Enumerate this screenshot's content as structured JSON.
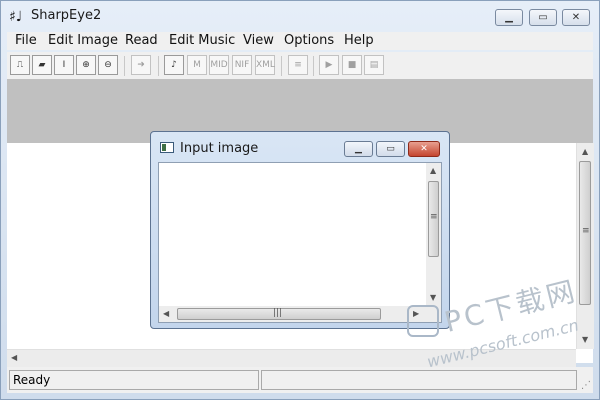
{
  "app": {
    "title": "SharpEye2",
    "icon": "sharp-note-icon",
    "icon_glyph": "♯♩",
    "caption": {
      "minimize": "▁",
      "maximize": "▭",
      "close": "✕"
    }
  },
  "menubar": {
    "items": [
      "File",
      "Edit Image",
      "Read",
      "Edit Music",
      "View",
      "Options",
      "Help"
    ]
  },
  "toolbar": {
    "buttons": [
      {
        "icon": "scanner-icon",
        "glyph": "⎍"
      },
      {
        "icon": "open-folder-icon",
        "glyph": "▰"
      },
      {
        "icon": "text-icon",
        "glyph": "I"
      },
      {
        "icon": "zoom-in-icon",
        "glyph": "⊕"
      },
      {
        "icon": "zoom-out-icon",
        "glyph": "⊖"
      },
      {
        "icon": "arrow-right-icon",
        "glyph": "➜"
      },
      {
        "icon": "open-music-icon",
        "glyph": "♪"
      },
      {
        "icon": "m-icon",
        "glyph": "M"
      },
      {
        "icon": "mid-icon",
        "glyph": "MID"
      },
      {
        "icon": "nif-icon",
        "glyph": "NIF"
      },
      {
        "icon": "xml-icon",
        "glyph": "XML"
      },
      {
        "icon": "staff-icon",
        "glyph": "≡"
      },
      {
        "icon": "play-icon",
        "glyph": "▶"
      },
      {
        "icon": "stop-icon",
        "glyph": "■"
      },
      {
        "icon": "score-icon",
        "glyph": "▤"
      }
    ]
  },
  "status": {
    "text": "Ready"
  },
  "child_window": {
    "title": "Input image",
    "icon": "image-window-icon",
    "caption": {
      "minimize": "▁",
      "maximize": "▭",
      "close": "✕"
    }
  },
  "watermark": {
    "line1": "PC下载网",
    "line2": "www.pcsoft.com.cn",
    "logo": "pcsoft-logo"
  },
  "colors": {
    "gray_band": "#c0c0c0",
    "client": "#ffffff",
    "close_button": "#c4452f"
  }
}
